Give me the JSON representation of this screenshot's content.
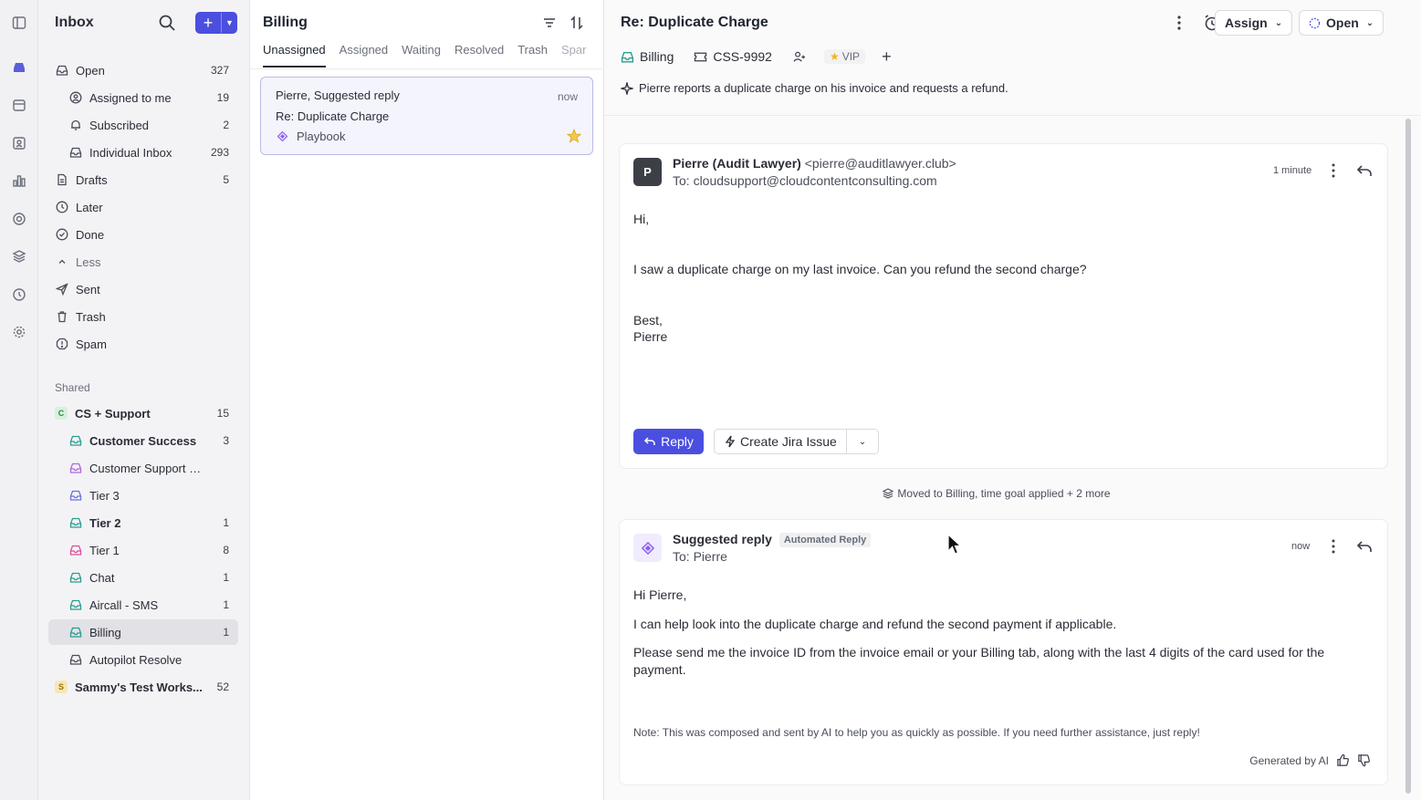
{
  "sidebar": {
    "title": "Inbox",
    "items": [
      {
        "label": "Open",
        "count": "327"
      },
      {
        "label": "Assigned to me",
        "count": "19"
      },
      {
        "label": "Subscribed",
        "count": "2"
      },
      {
        "label": "Individual Inbox",
        "count": "293"
      },
      {
        "label": "Drafts",
        "count": "5"
      },
      {
        "label": "Later",
        "count": ""
      },
      {
        "label": "Done",
        "count": ""
      },
      {
        "label": "Less",
        "count": ""
      },
      {
        "label": "Sent",
        "count": ""
      },
      {
        "label": "Trash",
        "count": ""
      },
      {
        "label": "Spam",
        "count": ""
      }
    ],
    "shared_header": "Shared",
    "shared": [
      {
        "label": "CS + Support",
        "count": "15",
        "badge": "C"
      },
      {
        "label": "Customer Success",
        "count": "3"
      },
      {
        "label": "Customer Support Webf...",
        "count": ""
      },
      {
        "label": "Tier 3",
        "count": ""
      },
      {
        "label": "Tier 2",
        "count": "1"
      },
      {
        "label": "Tier 1",
        "count": "8"
      },
      {
        "label": "Chat",
        "count": "1"
      },
      {
        "label": "Aircall - SMS",
        "count": "1"
      },
      {
        "label": "Billing",
        "count": "1"
      },
      {
        "label": "Autopilot Resolve",
        "count": ""
      },
      {
        "label": "Sammy's Test Works...",
        "count": "52",
        "badge": "S"
      }
    ],
    "colors": {
      "accent": "#4b4fe0",
      "teal": "#2a9d8f",
      "purple": "#8a6df0",
      "pink": "#d9509a"
    }
  },
  "list": {
    "title": "Billing",
    "tabs": [
      "Unassigned",
      "Assigned",
      "Waiting",
      "Resolved",
      "Trash",
      "Spar"
    ],
    "conversation": {
      "from": "Pierre, Suggested reply",
      "time": "now",
      "subject": "Re: Duplicate Charge",
      "tag": "Playbook"
    }
  },
  "detail": {
    "title": "Re: Duplicate Charge",
    "assign_label": "Assign",
    "status_label": "Open",
    "meta": {
      "inbox": "Billing",
      "ticket": "CSS-9992",
      "vip": "VIP"
    },
    "summary": "Pierre reports a duplicate charge on his invoice and requests a refund.",
    "message1": {
      "avatar": "P",
      "from_name": "Pierre (Audit Lawyer)",
      "from_addr": "<pierre@auditlawyer.club>",
      "to": "To: cloudsupport@cloudcontentconsulting.com",
      "time": "1 minute",
      "lines": [
        "Hi,",
        "I saw a duplicate charge on my last invoice. Can you refund the second charge?",
        "Best,",
        "Pierre"
      ],
      "reply_label": "Reply",
      "jira_label": "Create Jira Issue"
    },
    "activity": "Moved to Billing, time goal applied + 2 more",
    "message2": {
      "from_name": "Suggested reply",
      "badge": "Automated Reply",
      "to": "To: Pierre",
      "time": "now",
      "lines": [
        "Hi Pierre,",
        "I can help look into the duplicate charge and refund the second payment if applicable.",
        "Please send me the invoice ID from the invoice email or your Billing tab, along with the last 4 digits of the card used for the",
        "payment."
      ],
      "note": "Note: This was composed and sent by AI to help you as quickly as possible. If you need further assistance, just reply!",
      "generated": "Generated by AI"
    }
  }
}
